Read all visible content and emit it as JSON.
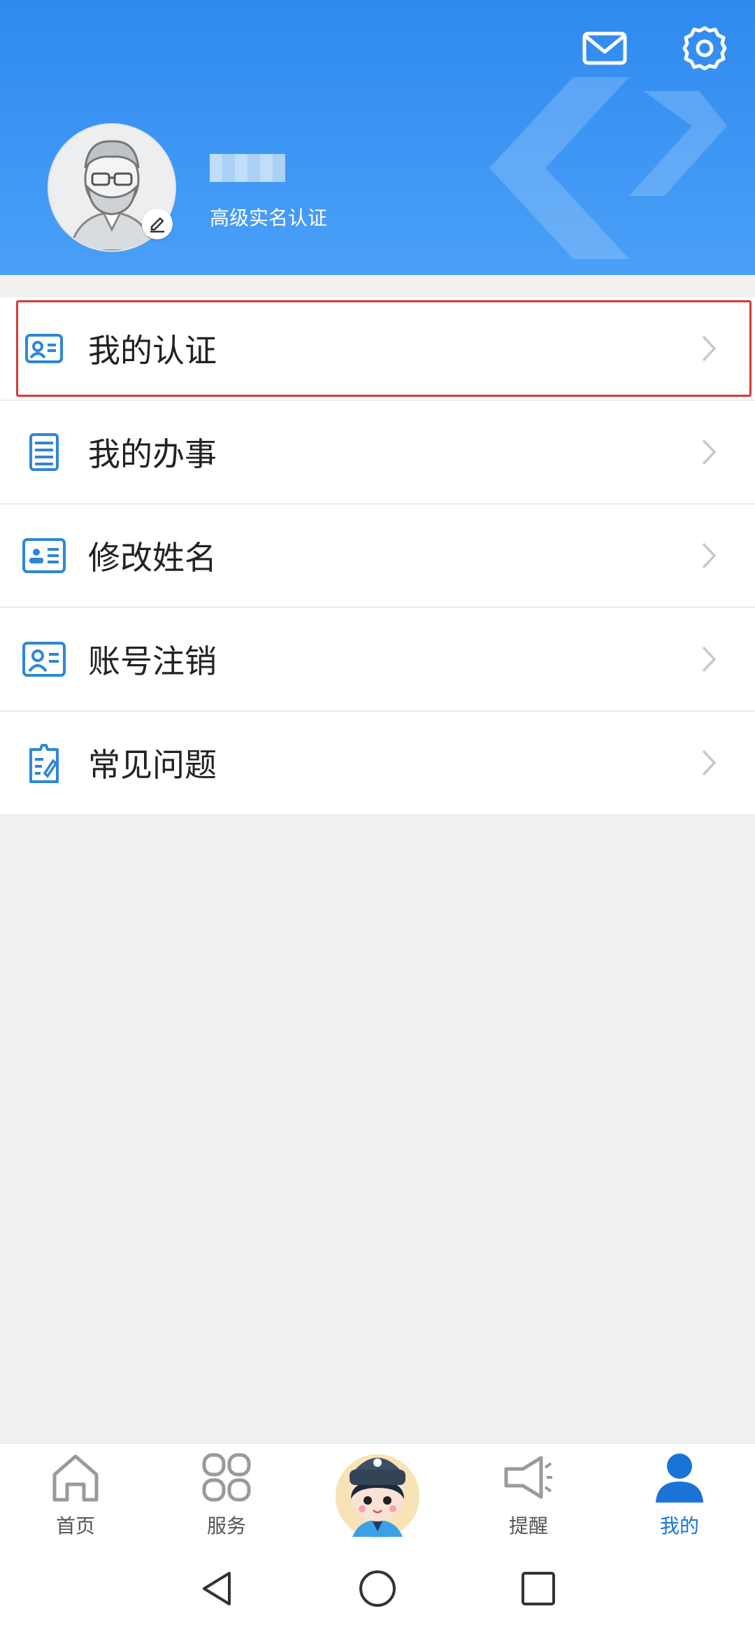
{
  "header": {
    "mail_icon": "mail-icon",
    "settings_icon": "gear-icon",
    "auth_level": "高级实名认证",
    "colors": {
      "gradient_top": "#2f8af0",
      "gradient_bottom": "#4aa0f7"
    }
  },
  "menu": {
    "items": [
      {
        "label": "我的认证",
        "icon": "id-card-icon",
        "highlighted": true
      },
      {
        "label": "我的办事",
        "icon": "list-document-icon"
      },
      {
        "label": "修改姓名",
        "icon": "name-card-icon"
      },
      {
        "label": "账号注销",
        "icon": "account-card-icon"
      },
      {
        "label": "常见问题",
        "icon": "faq-document-icon"
      }
    ]
  },
  "tabbar": {
    "tabs": [
      {
        "label": "首页",
        "icon": "home-icon"
      },
      {
        "label": "服务",
        "icon": "services-grid-icon"
      },
      {
        "label": "",
        "icon": "mascot-officer-icon"
      },
      {
        "label": "提醒",
        "icon": "megaphone-icon"
      },
      {
        "label": "我的",
        "icon": "user-icon",
        "active": true
      }
    ]
  },
  "navbar": {
    "back": "back-icon",
    "home": "home-circle-icon",
    "recents": "recents-icon"
  },
  "colors": {
    "accent": "#1a74d8",
    "highlight_border": "#d93a3a",
    "icon_blue": "#2f86d6"
  }
}
